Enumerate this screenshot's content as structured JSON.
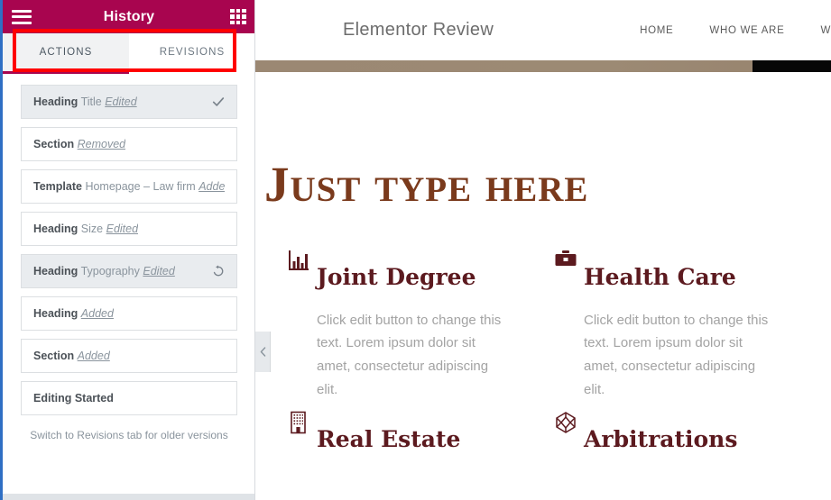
{
  "panel": {
    "header": {
      "title": "History",
      "menu_icon": "hamburger-icon",
      "apps_icon": "grid-icon"
    },
    "tabs": [
      {
        "label": "ACTIONS",
        "active": true
      },
      {
        "label": "REVISIONS",
        "active": false
      }
    ],
    "history_items": [
      {
        "element": "Heading",
        "subtitle": "Title",
        "status": "Edited",
        "action_icon": "check-icon",
        "current": true
      },
      {
        "element": "Section",
        "subtitle": "",
        "status": "Removed",
        "action_icon": "",
        "current": false
      },
      {
        "element": "Template",
        "subtitle": "Homepage – Law firm",
        "status": "Added",
        "action_icon": "",
        "current": false
      },
      {
        "element": "Heading",
        "subtitle": "Size",
        "status": "Edited",
        "action_icon": "",
        "current": false
      },
      {
        "element": "Heading",
        "subtitle": "Typography",
        "status": "Edited",
        "action_icon": "revert-icon",
        "current": false
      },
      {
        "element": "Heading",
        "subtitle": "",
        "status": "Added",
        "action_icon": "",
        "current": false
      },
      {
        "element": "Section",
        "subtitle": "",
        "status": "Added",
        "action_icon": "",
        "current": false
      },
      {
        "element": "Editing Started",
        "subtitle": "",
        "status": "",
        "action_icon": "",
        "current": false
      }
    ],
    "note": "Switch to Revisions tab for older versions",
    "accent_color": "#a8054f",
    "annotation_color": "#ff0000"
  },
  "preview": {
    "collapse_icon": "chevron-left-icon",
    "site": {
      "logo": "Elementor Review",
      "nav": [
        {
          "label": "HOME"
        },
        {
          "label": "WHO WE ARE"
        },
        {
          "label": "W"
        }
      ],
      "page_heading": "Just type here",
      "services": [
        {
          "icon": "bar-chart-icon",
          "title": "Joint Degree",
          "text": "Click edit button to change this text. Lorem ipsum dolor sit amet, consectetur adipiscing elit."
        },
        {
          "icon": "briefcase-icon",
          "title": "Health Care",
          "text": "Click edit button to change this text. Lorem ipsum dolor sit amet, consectetur adipiscing elit."
        },
        {
          "icon": "building-icon",
          "title": "Real Estate",
          "text": ""
        },
        {
          "icon": "cube-icon",
          "title": "Arbitrations",
          "text": ""
        }
      ],
      "heading_color": "#7a3a1c",
      "service_color": "#5c1a1f"
    }
  }
}
